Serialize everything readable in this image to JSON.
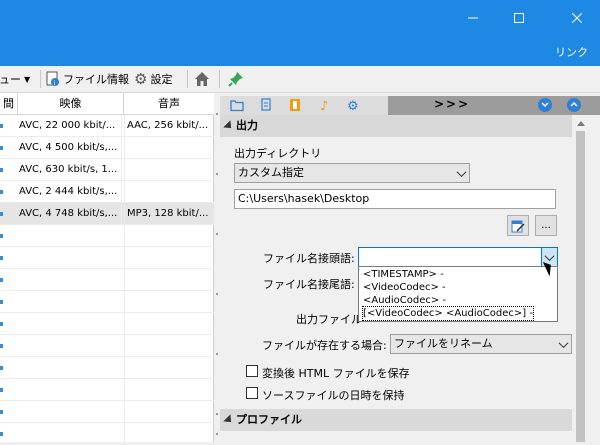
{
  "window": {
    "minimize_icon": "minimize-icon",
    "maximize_icon": "maximize-icon",
    "close_icon": "close-icon"
  },
  "menubar": {
    "link_label": "リンク"
  },
  "toolbar": {
    "view_label": "ビュー",
    "file_info_label": "ファイル情報",
    "settings_label": "設定"
  },
  "file_list": {
    "columns": [
      "間",
      "映像",
      "音声"
    ],
    "rows": [
      {
        "video": "AVC, 22 000 kbit/...",
        "audio": "AAC, 256 kbit/..."
      },
      {
        "video": "AVC, 4 500 kbit/s,...",
        "audio": ""
      },
      {
        "video": "AVC, 630 kbit/s, 1...",
        "audio": ""
      },
      {
        "video": "AVC, 2 444 kbit/s,...",
        "audio": ""
      },
      {
        "video": "AVC, 4 748 kbit/s,...",
        "audio": "MP3, 128 kbit/..."
      }
    ]
  },
  "tabs": {
    "more_label": ">>>"
  },
  "output_section": {
    "title": "出力",
    "dir_label": "出力ディレクトリ",
    "dir_mode": "カスタム指定",
    "dir_path": "C:\\Users\\hasek\\Desktop",
    "browse_label": "...",
    "prefix_label": "ファイル名接頭語:",
    "prefix_value": "",
    "suffix_label": "ファイル名接尾語:",
    "output_file_label": "出力ファイル",
    "exists_label": "ファイルが存在する場合:",
    "exists_value": "ファイルをリネーム",
    "html_checkbox_label": "変換後 HTML ファイルを保存",
    "date_checkbox_label": "ソースファイルの日時を保持"
  },
  "dropdown_options": [
    "<TIMESTAMP> -",
    "<VideoCodec> -",
    "<AudioCodec> -",
    "[<VideoCodec> <AudioCodec>] -"
  ],
  "profile_section": {
    "title": "プロファイル"
  },
  "colors": {
    "titlebar": "#1e88e5",
    "accent_icon": "#2f7fd6",
    "pin_icon": "#3aa655"
  }
}
